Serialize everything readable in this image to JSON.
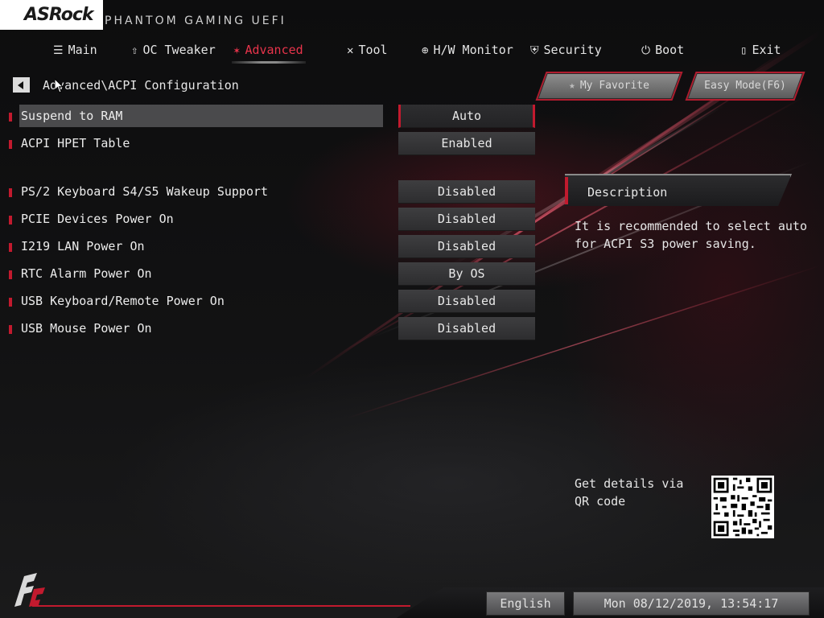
{
  "header": {
    "brand": "ASRock",
    "product": "PHANTOM GAMING UEFI"
  },
  "tabs": [
    {
      "label": "Main",
      "icon": "list-icon",
      "active": false
    },
    {
      "label": "OC Tweaker",
      "icon": "rocket-icon",
      "active": false
    },
    {
      "label": "Advanced",
      "icon": "star-icon",
      "active": true
    },
    {
      "label": "Tool",
      "icon": "tools-icon",
      "active": false
    },
    {
      "label": "H/W Monitor",
      "icon": "crosshair-icon",
      "active": false
    },
    {
      "label": "Security",
      "icon": "shield-icon",
      "active": false
    },
    {
      "label": "Boot",
      "icon": "power-icon",
      "active": false
    },
    {
      "label": "Exit",
      "icon": "exit-door-icon",
      "active": false
    }
  ],
  "breadcrumb": "Advanced\\ACPI Configuration",
  "buttons": {
    "favorite": "My Favorite",
    "easy_mode": "Easy Mode(F6)"
  },
  "settings": [
    {
      "label": "Suspend to RAM",
      "value": "Auto",
      "selected": true
    },
    {
      "label": "ACPI HPET Table",
      "value": "Enabled",
      "selected": false
    },
    {
      "label": "PS/2 Keyboard S4/S5 Wakeup Support",
      "value": "Disabled",
      "selected": false
    },
    {
      "label": "PCIE Devices Power On",
      "value": "Disabled",
      "selected": false
    },
    {
      "label": "I219 LAN Power On",
      "value": "Disabled",
      "selected": false
    },
    {
      "label": "RTC Alarm Power On",
      "value": "By OS",
      "selected": false
    },
    {
      "label": "USB Keyboard/Remote Power On",
      "value": "Disabled",
      "selected": false
    },
    {
      "label": "USB Mouse Power On",
      "value": "Disabled",
      "selected": false
    }
  ],
  "description": {
    "title": "Description",
    "text": "It is recommended to select auto for ACPI S3 power saving."
  },
  "qr": {
    "text": "Get details via QR code"
  },
  "footer": {
    "language": "English",
    "datetime": "Mon 08/12/2019, 13:54:17"
  },
  "colors": {
    "accent": "#c21a2e",
    "active_tab": "#e8344b"
  }
}
